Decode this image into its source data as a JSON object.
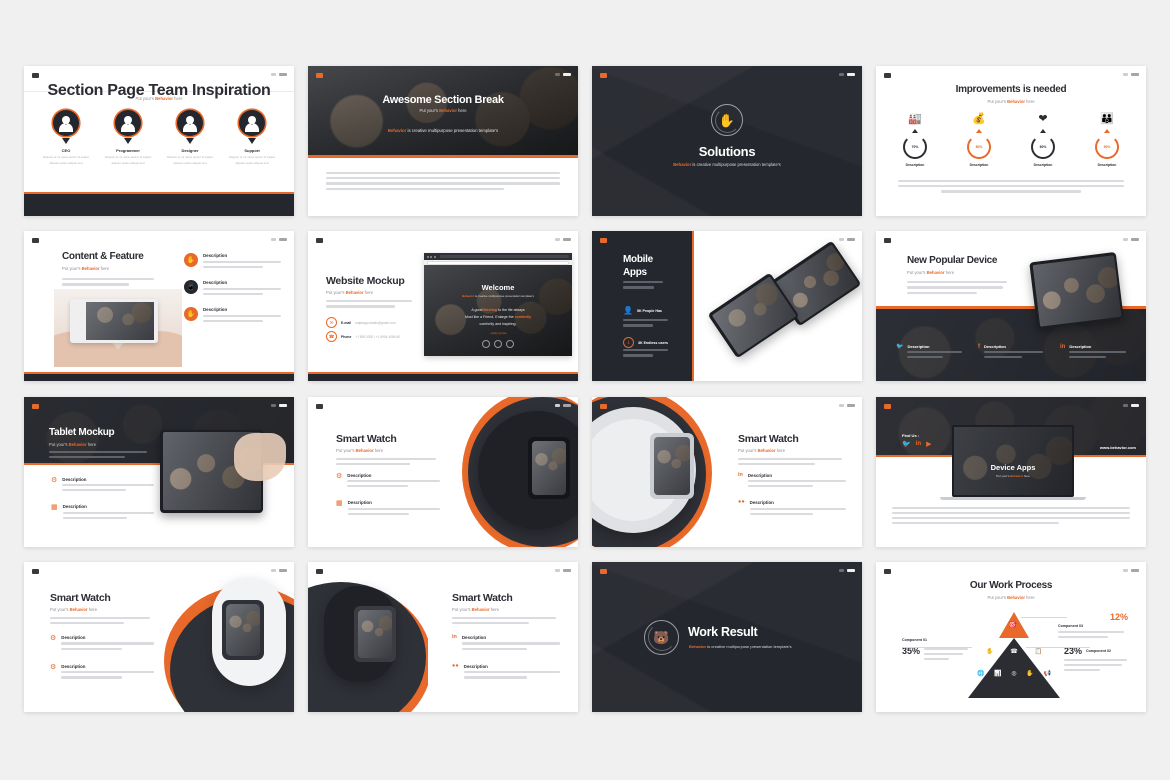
{
  "meta": {
    "brand": "Behavior",
    "tagline_sub": "Put your's tagline here",
    "tagline_brandline": "is creative multipurpose presentation template's",
    "accent": "#e8692a",
    "dark": "#25272e",
    "page_bg": "#f0f0f0"
  },
  "slides": [
    {
      "id": "section-page-team-inspiration",
      "title": "Section Page Team Inspiration",
      "subtitle": "Put your's tagline here",
      "theme": "light",
      "members": [
        {
          "role": "CEO",
          "desc": "Aliquam et mi netus auctor id sapien aliquam quam aliquet sed"
        },
        {
          "role": "Programmer",
          "desc": "Aliquam et mi netus auctor id sapien aliquam quam aliquet sed"
        },
        {
          "role": "Designer",
          "desc": "Aliquam et mi netus auctor id sapien aliquam quam aliquet sed"
        },
        {
          "role": "Support",
          "desc": "Aliquam et mi netus auctor id sapien aliquam quam aliquet sed"
        }
      ]
    },
    {
      "id": "awesome-section-break",
      "title": "Awesome Section Break",
      "subtitle": "Put your's tagline here",
      "brandline_brand": "Behavior",
      "brandline_rest": "is creative multipurpose presentation template's",
      "theme": "photo",
      "body": "Accumsan arcu nibh metus auctor id sapien quam aliquet sed pretium vitae ornare praesent cursus praesent nulla ante malesuada."
    },
    {
      "id": "solutions",
      "title": "Solutions",
      "brandline_brand": "Behavior",
      "brandline_rest": "is creative multipurpose presentation template's",
      "theme": "dark",
      "icon": "hand-touch-icon"
    },
    {
      "id": "improvements-is-needed",
      "title": "Improvements is needed",
      "subtitle": "Put your's tagline here",
      "theme": "light",
      "stats": [
        {
          "value": "70%",
          "label": "Description",
          "color": "dark",
          "icon": "factory-icon"
        },
        {
          "value": "80%",
          "label": "Description",
          "color": "orange",
          "icon": "money-icon"
        },
        {
          "value": "60%",
          "label": "Description",
          "color": "dark",
          "icon": "heart-hands-icon"
        },
        {
          "value": "90%",
          "label": "Description",
          "color": "orange",
          "icon": "people-icon"
        }
      ],
      "body": "Accumsan arcu nibh metus auctor id sapien quam aliquet sed pretium vitae ornare praesent cursus praesent nulla ante malesuada quam."
    },
    {
      "id": "content-and-feature",
      "title": "Content & Feature",
      "subtitle": "Put your's tagline here",
      "theme": "light",
      "body": "Accumsan arcu nibh metus auctor id sapien quam aliquam sed pretium id accumsan praesent lupus ante.",
      "features": [
        {
          "heading": "Description",
          "text": "Accumsan arcu nibh metus auctor id sapien accumsan aliquet sed",
          "icon": "hand-icon",
          "color": "orange"
        },
        {
          "heading": "Description",
          "text": "Accumsan arcu nibh metus auctor id sapien accumsan aliquet sed",
          "icon": "mobile-icon",
          "color": "dark"
        },
        {
          "heading": "Description",
          "text": "Accumsan arcu nibh metus auctor id sapien accumsan aliquet sed",
          "icon": "touch-icon",
          "color": "orange"
        }
      ]
    },
    {
      "id": "website-mockup",
      "title": "Website Mockup",
      "subtitle": "Put your's tagline here",
      "theme": "light",
      "body": "Accumsan arcu nibh metus auctor id sapien quam aliquet sed pretium ornare tempor.",
      "contacts": [
        {
          "icon": "mail-icon",
          "label": "E-mail",
          "value": "majeargo.studio@gmail.com"
        },
        {
          "icon": "phone-icon",
          "label": "Phone",
          "value": "+1 859 3030 / +1 6904 4056 80"
        }
      ],
      "mockup": {
        "welcome": "Welcome",
        "welcome_sub_brand": "Behavior",
        "welcome_sub": "is creative multipurpose presentation template's",
        "quote_line1_a": "A good",
        "quote_line1_hl": "Meeting",
        "quote_line1_b": "to the life always",
        "quote_line2": "Must like a Friend, Enlarge the",
        "quote_line2_hl": "comfortly",
        "quote_line3": "comfortly and inspiring.",
        "author": "- Andy Lyman"
      }
    },
    {
      "id": "mobile-apps",
      "title_line1": "Mobile",
      "title_line2": "Apps",
      "theme": "split-dark",
      "body": "Accumsan arcu amet consectetuer sed",
      "stats": [
        {
          "icon": "person-icon",
          "value": "5K People Has",
          "text": "some quis odio sit amet consectetuer sit"
        },
        {
          "icon": "download-icon",
          "value": "3K Endless users",
          "text": "Lorem quis odio sit amet consectetuer sit"
        }
      ]
    },
    {
      "id": "new-popular-device",
      "title": "New Popular Device",
      "subtitle": "Put your's tagline here",
      "theme": "split-photo",
      "body": "Accumsan arcu nibh metus auctor id sapien quam aliquam sed pretium ornare praesent lupus ante nulla malesuada quam suscipit varius tincidunt dapibus integer mollis.",
      "socials": [
        {
          "icon": "twitter-icon",
          "heading": "Description",
          "text": "Accumsan arcu nibh metus auctor id sapien"
        },
        {
          "icon": "facebook-icon",
          "heading": "Description",
          "text": "Accumsan arcu nibh metus auctor id sapien"
        },
        {
          "icon": "linkedin-icon",
          "heading": "Description",
          "text": "Accumsan arcu nibh metus auctor id sapien"
        }
      ]
    },
    {
      "id": "tablet-mockup",
      "title": "Tablet Mockup",
      "subtitle": "Put your's tagline here",
      "theme": "dark-top",
      "body": "Accumsan arcu nibh metus auctor id sapien quam aliquam sed pretium ornare aliquam praesent lupus ante quam",
      "features": [
        {
          "icon": "gear-icon",
          "heading": "Description",
          "text": "Accumsan arcu nibh metus auctor id sapien aliquam laoreet ipsum dolor sed amet"
        },
        {
          "icon": "window-icon",
          "heading": "Description",
          "text": "Accumsan arcu nibh metus auctor id sapien aliquam laoreet ipsum dolor sed amet"
        }
      ]
    },
    {
      "id": "smart-watch-1",
      "title": "Smart Watch",
      "subtitle": "Put your's tagline here",
      "theme": "light",
      "body": "Accumsan arcu nibh metus auctor id sapien quam aliquam sed pretium ornare praesent lupus ante nulla",
      "features": [
        {
          "icon": "gear-icon",
          "heading": "Description",
          "text": "Accumsan arcu nibh metus auctor id sapien aliquam ornare id lorem ipsum ante amet"
        },
        {
          "icon": "window-icon",
          "heading": "Description",
          "text": "Accumsan arcu nibh metus auctor id sapien aliquam ornare id lorem ipsum ante amet"
        }
      ],
      "watch": "black-sport-band"
    },
    {
      "id": "smart-watch-2",
      "title": "Smart Watch",
      "subtitle": "Put your's tagline here",
      "theme": "light-reverse",
      "body": "Accumsan arcu nibh metus auctor id sapien quam aliquam sed pretium ornare praesent lupus ante nulla",
      "features": [
        {
          "icon": "linkedin-icon",
          "heading": "Description",
          "text": "Accumsan arcu nibh metus auctor id sapien aliquam ornare id lorem ipsum ante amet"
        },
        {
          "icon": "dribbble-icon",
          "heading": "Description",
          "text": "Accumsan arcu nibh metus auctor id sapien aliquam ornare id lorem ipsum ante amet"
        }
      ],
      "watch": "silver-link-band"
    },
    {
      "id": "device-apps",
      "title": "Device Apps",
      "subtitle": "Put your's tagline here",
      "theme": "dark-top-photo",
      "find_us_label": "Find Us :",
      "website": "www.behavior.com",
      "socials": [
        "twitter-icon",
        "linkedin-icon",
        "youtube-icon"
      ],
      "body": "Accumsan arcu nibh metus auctor id sapien quam aliquet sed pretium ornare praesent lupus ante nulla malesuada quam suscipit tincidunt dapibus integer mollis dui vel magna condimentum nulla vitae auctor pellentesque."
    },
    {
      "id": "smart-watch-3",
      "title": "Smart Watch",
      "subtitle": "Put your's tagline here",
      "theme": "light",
      "body": "Accumsan arcu nibh metus auctor id sapien quam aliquam sed pretium ornare praesent lupus ante nulla",
      "features": [
        {
          "icon": "gear-icon",
          "heading": "Description",
          "text": "Accumsan arcu nibh metus auctor id sapien aliquam ornare id lorem ipsum ante amet"
        },
        {
          "icon": "gear-icon",
          "heading": "Description",
          "text": "Accumsan arcu nibh metus auctor id sapien aliquam ornare id lorem ipsum ante amet"
        }
      ],
      "watch": "white-sport-band"
    },
    {
      "id": "smart-watch-4",
      "title": "Smart Watch",
      "subtitle": "Put your's tagline here",
      "theme": "light-reverse",
      "body": "Accumsan arcu nibh metus auctor id sapien quam aliquam sed pretium ornare praesent lupus ante nulla",
      "features": [
        {
          "icon": "linkedin-icon",
          "heading": "Description",
          "text": "Accumsan arcu nibh metus auctor id sapien aliquam ornare id lorem ipsum ante amet"
        },
        {
          "icon": "dribbble-icon",
          "heading": "Description",
          "text": "Accumsan arcu nibh metus auctor id sapien aliquam ornare id lorem ipsum ante amet"
        }
      ],
      "watch": "black-link-band"
    },
    {
      "id": "work-result",
      "title": "Work Result",
      "brandline_brand": "Behavior",
      "brandline_rest": "is creative multipurpose presentation template's",
      "theme": "dark",
      "icon": "bear-logo-icon"
    },
    {
      "id": "our-work-process",
      "title": "Our Work Process",
      "subtitle": "Put your's tagline here",
      "theme": "light",
      "components": [
        {
          "name": "Component 01",
          "value": "35%",
          "color": "dark",
          "text": "Praesent arcu nibh metus auctor id dapibus quam aliquam sed pretium ornare praesent"
        },
        {
          "name": "Component 02",
          "value": "23%",
          "color": "dark",
          "text": "Aliquam arcu nibh metus auctor id dapibus quam aliquam sed pretium ornare sed praesent"
        },
        {
          "name": "Component 03",
          "value": "12%",
          "color": "orange",
          "text": "Praesent arcu nibh metus auctor id dapibus quam aliquam sed"
        }
      ]
    }
  ],
  "chart_data": {
    "type": "pie",
    "title": "Our Work Process",
    "categories": [
      "Component 01",
      "Component 02",
      "Component 03"
    ],
    "values": [
      35,
      23,
      12
    ],
    "labels": [
      "35%",
      "23%",
      "12%"
    ],
    "colors": [
      "#2b2d33",
      "#2b2d33",
      "#e8692a"
    ]
  }
}
